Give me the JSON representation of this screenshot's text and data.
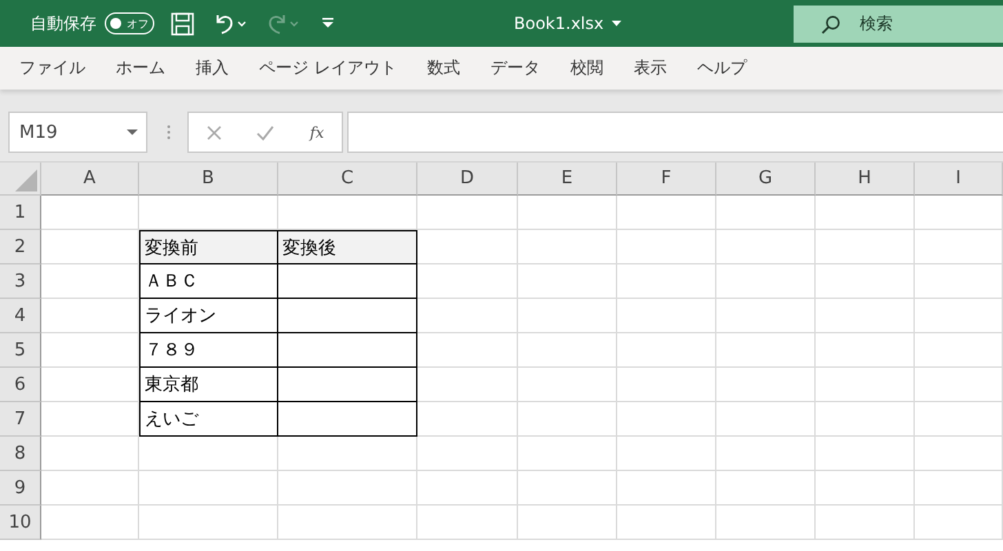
{
  "title_bar": {
    "autosave_label": "自動保存",
    "autosave_toggle": {
      "label": "オフ",
      "on": false
    },
    "undo_enabled": true,
    "redo_enabled": false,
    "title": "Book1.xlsx",
    "search": {
      "placeholder": "検索"
    }
  },
  "ribbon_tabs": [
    "ファイル",
    "ホーム",
    "挿入",
    "ページ レイアウト",
    "数式",
    "データ",
    "校閲",
    "表示",
    "ヘルプ"
  ],
  "name_box": "M19",
  "formula_bar": {
    "function_label": "fx"
  },
  "sheet": {
    "columns": [
      "A",
      "B",
      "C",
      "D",
      "E",
      "F",
      "G",
      "H",
      "I"
    ],
    "rows": [
      {
        "number": "1"
      },
      {
        "number": "2",
        "table": [
          "変換前",
          "変換後"
        ],
        "header": true
      },
      {
        "number": "3",
        "table": [
          "ＡＢＣ"
        ],
        "header": false
      },
      {
        "number": "4",
        "table": [
          "ライオン"
        ],
        "header": false
      },
      {
        "number": "5",
        "table": [
          "７８９"
        ],
        "header": false
      },
      {
        "number": "6",
        "table": [
          "東京都"
        ],
        "header": false
      },
      {
        "number": "7",
        "table": [
          "えいご"
        ],
        "header": false
      },
      {
        "number": "8"
      },
      {
        "number": "9"
      },
      {
        "number": "10"
      }
    ]
  }
}
